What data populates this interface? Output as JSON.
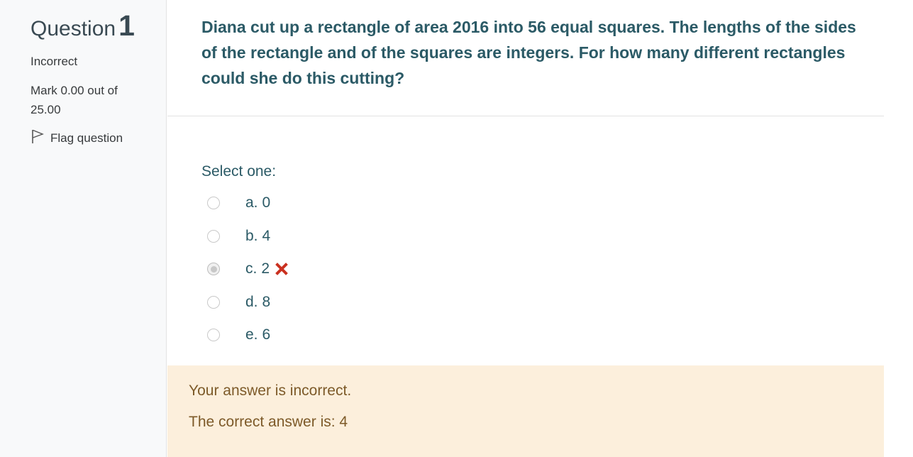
{
  "info": {
    "question_word": "Question",
    "question_number": "1",
    "state": "Incorrect",
    "grade": "Mark 0.00 out of 25.00",
    "flag_label": "Flag question",
    "flag_icon": "flag-icon"
  },
  "question": {
    "text": "Diana cut up a rectangle of area 2016 into 56 equal squares. The lengths of the sides of the rectangle and of the squares are integers. For how many different rectangles could she do this cutting?",
    "prompt": "Select one:",
    "options": [
      {
        "letter": "a.",
        "value": "0",
        "selected": false
      },
      {
        "letter": "b.",
        "value": "4",
        "selected": false
      },
      {
        "letter": "c.",
        "value": "2",
        "selected": true,
        "mark_icon": "incorrect-cross-icon"
      },
      {
        "letter": "d.",
        "value": "8",
        "selected": false
      },
      {
        "letter": "e.",
        "value": "6",
        "selected": false
      }
    ]
  },
  "feedback": {
    "status": "Your answer is incorrect.",
    "correct_answer": "The correct answer is: 4"
  },
  "colors": {
    "question_text": "#2b5a66",
    "heading": "#3a4a53",
    "feedback_bg": "#fcefdc",
    "feedback_text": "#7d5a29",
    "incorrect_icon": "#ca3120"
  }
}
